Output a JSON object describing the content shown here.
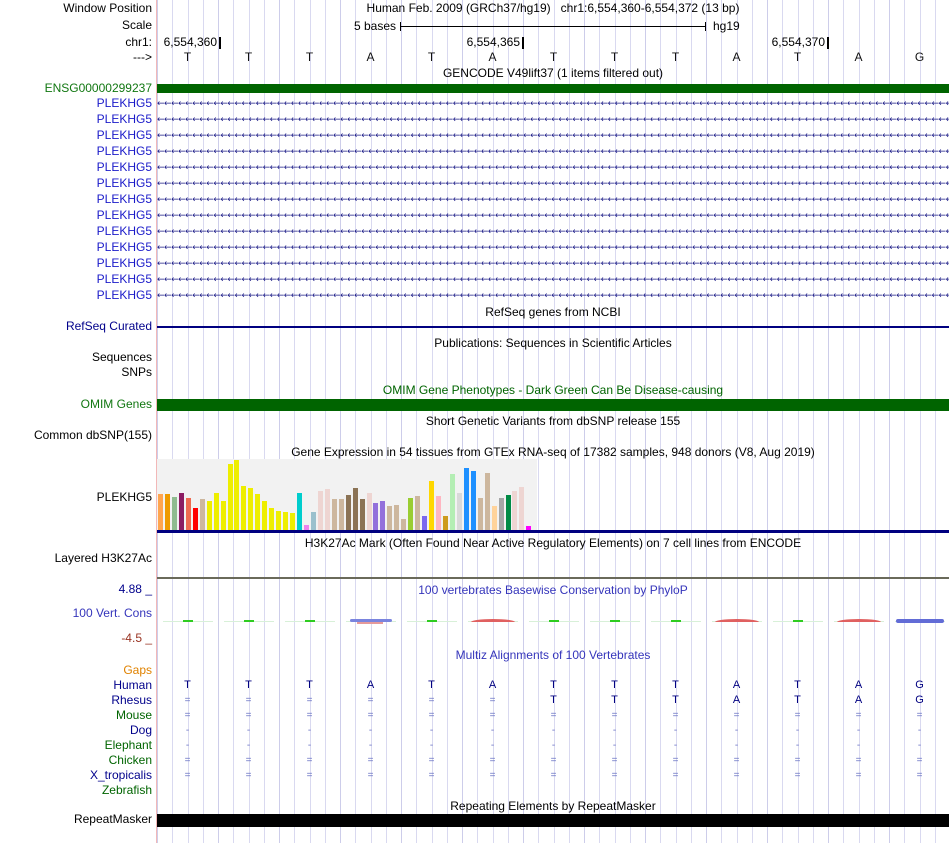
{
  "header": {
    "window_position_label": "Window Position",
    "position_text": "Human Feb. 2009 (GRCh37/hg19)   chr1:6,554,360-6,554,372 (13 bp)",
    "scale_label": "Scale",
    "scale_value": "5 bases",
    "assembly": "hg19",
    "chrom_label": "chr1:",
    "coordinate_ticks": [
      "6,554,360",
      "6,554,365",
      "6,554,370"
    ],
    "strand_label": "--->",
    "bases": [
      "T",
      "T",
      "T",
      "A",
      "T",
      "A",
      "T",
      "T",
      "T",
      "A",
      "T",
      "A",
      "G"
    ]
  },
  "tracks": {
    "gencode": {
      "title": "GENCODE V49lift37 (1 items filtered out)",
      "gene_label": "ENSG00000299237",
      "transcript_label": "PLEKHG5",
      "transcript_count": 13,
      "bar_color": "#006400"
    },
    "refseq": {
      "title": "RefSeq genes from NCBI",
      "label": "RefSeq Curated"
    },
    "publications": {
      "title": "Publications: Sequences in Scientific Articles",
      "row1_label": "Sequences",
      "row2_label": "SNPs"
    },
    "omim": {
      "title": "OMIM Gene Phenotypes - Dark Green Can Be Disease-causing",
      "label": "OMIM Genes",
      "bar_color": "#006400"
    },
    "dbsnp": {
      "title": "Short Genetic Variants from dbSNP release 155",
      "label": "Common dbSNP(155)"
    },
    "gtex": {
      "title": "Gene Expression in 54 tissues from GTEx RNA-seq of 17382 samples, 948 donors (V8, Aug 2019)",
      "label": "PLEKHG5"
    },
    "h3k27ac": {
      "title": "H3K27Ac Mark (Often Found Near Active Regulatory Elements) on 7 cell lines from ENCODE",
      "label": "Layered H3K27Ac"
    },
    "phylop": {
      "title": "100 vertebrates Basewise Conservation by PhyloP",
      "label": "100 Vert. Cons",
      "axis_max": "4.88 _",
      "axis_min": "-4.5 _",
      "marks": [
        "green",
        "green",
        "green",
        "blue",
        "green",
        "red",
        "green",
        "green",
        "green",
        "red",
        "green",
        "red",
        "blue2"
      ]
    },
    "multiz": {
      "title": "Multiz Alignments of 100 Vertebrates",
      "gaps_label": "Gaps",
      "rows": [
        {
          "name": "Human",
          "color": "navy",
          "cells": [
            "T",
            "T",
            "T",
            "A",
            "T",
            "A",
            "T",
            "T",
            "T",
            "A",
            "T",
            "A",
            "G"
          ]
        },
        {
          "name": "Rhesus",
          "color": "navy",
          "cells": [
            "=",
            "=",
            "=",
            "=",
            "=",
            "=",
            "T",
            "T",
            "T",
            "A",
            "T",
            "A",
            "G"
          ]
        },
        {
          "name": "Mouse",
          "color": "green",
          "cells": [
            "=",
            "=",
            "=",
            "=",
            "=",
            "=",
            "=",
            "=",
            "=",
            "=",
            "=",
            "=",
            "="
          ]
        },
        {
          "name": "Dog",
          "color": "navy",
          "cells": [
            "-",
            "-",
            "-",
            "-",
            "-",
            "-",
            "-",
            "-",
            "-",
            "-",
            "-",
            "-",
            "-"
          ]
        },
        {
          "name": "Elephant",
          "color": "green",
          "cells": [
            "-",
            "-",
            "-",
            "-",
            "-",
            "-",
            "-",
            "-",
            "-",
            "-",
            "-",
            "-",
            "-"
          ]
        },
        {
          "name": "Chicken",
          "color": "green",
          "cells": [
            "=",
            "=",
            "=",
            "=",
            "=",
            "=",
            "=",
            "=",
            "=",
            "=",
            "=",
            "=",
            "="
          ]
        },
        {
          "name": "X_tropicalis",
          "color": "navy",
          "cells": [
            "=",
            "=",
            "=",
            "=",
            "=",
            "=",
            "=",
            "=",
            "=",
            "=",
            "=",
            "=",
            "="
          ]
        },
        {
          "name": "Zebrafish",
          "color": "green",
          "cells": [
            "",
            "",
            "",
            "",
            "",
            "",
            "",
            "",
            "",
            "",
            "",
            "",
            ""
          ]
        }
      ]
    },
    "repeatmasker": {
      "title": "Repeating Elements by RepeatMasker",
      "label": "RepeatMasker"
    }
  },
  "chart_data": {
    "type": "bar",
    "title": "Gene Expression in 54 tissues from GTEx RNA-seq of 17382 samples, 948 donors (V8, Aug 2019)",
    "gene": "PLEKHG5",
    "note": "54 GTEx tissue bars; heights are relative screen pixels (max 71), tissue names not rendered in image",
    "ylim": [
      0,
      71
    ],
    "bars": [
      {
        "c": "#FFA54F",
        "h": 37
      },
      {
        "c": "#EE9A00",
        "h": 37
      },
      {
        "c": "#8FBC8F",
        "h": 34
      },
      {
        "c": "#8B1C62",
        "h": 38
      },
      {
        "c": "#EE6A50",
        "h": 33
      },
      {
        "c": "#FF0000",
        "h": 23
      },
      {
        "c": "#CDB79E",
        "h": 32
      },
      {
        "c": "#EEEE00",
        "h": 30
      },
      {
        "c": "#EEEE00",
        "h": 38
      },
      {
        "c": "#EEEE00",
        "h": 30
      },
      {
        "c": "#EEEE00",
        "h": 67
      },
      {
        "c": "#EEEE00",
        "h": 71
      },
      {
        "c": "#EEEE00",
        "h": 45
      },
      {
        "c": "#EEEE00",
        "h": 43
      },
      {
        "c": "#EEEE00",
        "h": 37
      },
      {
        "c": "#EEEE00",
        "h": 30
      },
      {
        "c": "#EEEE00",
        "h": 23
      },
      {
        "c": "#EEEE00",
        "h": 20
      },
      {
        "c": "#EEEE00",
        "h": 19
      },
      {
        "c": "#EEEE00",
        "h": 18
      },
      {
        "c": "#00CDCD",
        "h": 38
      },
      {
        "c": "#EE82EE",
        "h": 6
      },
      {
        "c": "#9AC0CD",
        "h": 19
      },
      {
        "c": "#EED5D2",
        "h": 40
      },
      {
        "c": "#EED5D2",
        "h": 42
      },
      {
        "c": "#CDB79E",
        "h": 32
      },
      {
        "c": "#CDB79E",
        "h": 32
      },
      {
        "c": "#8B7355",
        "h": 36
      },
      {
        "c": "#8B7355",
        "h": 43
      },
      {
        "c": "#8B7355",
        "h": 32
      },
      {
        "c": "#EED5D2",
        "h": 38
      },
      {
        "c": "#9370DB",
        "h": 28
      },
      {
        "c": "#9370DB",
        "h": 30
      },
      {
        "c": "#CDB79E",
        "h": 25
      },
      {
        "c": "#CDB79E",
        "h": 26
      },
      {
        "c": "#CDB79E",
        "h": 12
      },
      {
        "c": "#9ACD32",
        "h": 33
      },
      {
        "c": "#CDB79E",
        "h": 35
      },
      {
        "c": "#7A67EE",
        "h": 15
      },
      {
        "c": "#FFD700",
        "h": 50
      },
      {
        "c": "#FFB6C1",
        "h": 35
      },
      {
        "c": "#CD9B1D",
        "h": 15
      },
      {
        "c": "#B4EEB4",
        "h": 57
      },
      {
        "c": "#D9D9D9",
        "h": 38
      },
      {
        "c": "#1E90FF",
        "h": 63
      },
      {
        "c": "#1E90FF",
        "h": 60
      },
      {
        "c": "#CDB79E",
        "h": 33
      },
      {
        "c": "#CDB79E",
        "h": 58
      },
      {
        "c": "#FFD39B",
        "h": 25
      },
      {
        "c": "#A6A6A6",
        "h": 33
      },
      {
        "c": "#008B45",
        "h": 36
      },
      {
        "c": "#EED5D2",
        "h": 40
      },
      {
        "c": "#EED5D2",
        "h": 44
      },
      {
        "c": "#FF00FF",
        "h": 5
      }
    ]
  }
}
